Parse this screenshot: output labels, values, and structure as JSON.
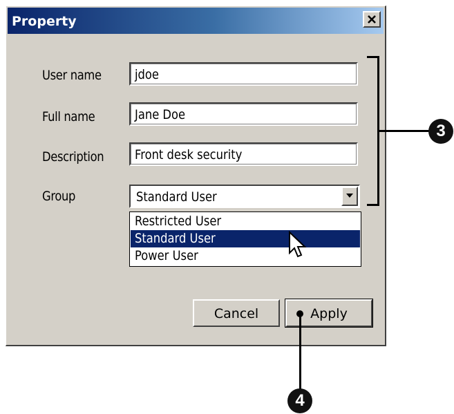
{
  "dialog": {
    "title": "Property",
    "close_icon": "close-icon"
  },
  "form": {
    "username_label": "User name",
    "username_value": "jdoe",
    "fullname_label": "Full name",
    "fullname_value": "Jane Doe",
    "description_label": "Description",
    "description_value": "Front desk security",
    "group_label": "Group",
    "group_value": "Standard User",
    "group_options": [
      {
        "label": "Restricted User",
        "selected": false
      },
      {
        "label": "Standard User",
        "selected": true
      },
      {
        "label": "Power User",
        "selected": false
      }
    ]
  },
  "buttons": {
    "cancel_label": "Cancel",
    "apply_label": "Apply"
  },
  "callouts": {
    "fields_callout": "3",
    "apply_callout": "4"
  },
  "colors": {
    "dialog_face": "#d4d0c8",
    "title_gradient_start": "#0a246a",
    "title_gradient_end": "#a6caf0",
    "selection": "#0a246a"
  }
}
